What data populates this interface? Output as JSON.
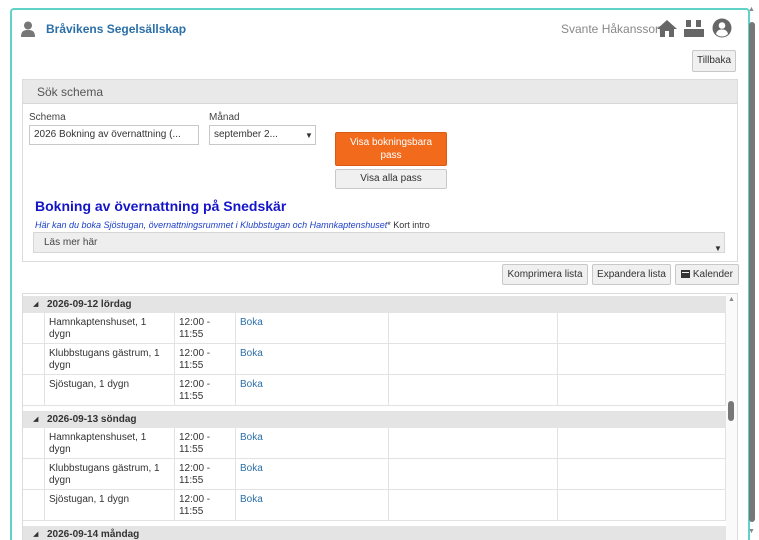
{
  "header": {
    "club_name": "Bråvikens Segelsällskap",
    "user_name": "Svante Håkansson"
  },
  "back_label": "Tillbaka",
  "search": {
    "panel_title": "Sök schema",
    "schema_label": "Schema",
    "schema_value": "2026 Bokning av övernattning (...",
    "month_label": "Månad",
    "month_value": "september 2...",
    "show_bookable": "Visa bokningsbara pass",
    "show_all": "Visa alla pass"
  },
  "booking": {
    "title": "Bokning av övernattning på Snedskär",
    "intro_italic": "Här kan du boka Sjöstugan, övernattningsrummet i Klubbstugan och Hamnkaptenshuset",
    "intro_suffix": "* Kort intro",
    "read_more": "Läs mer här"
  },
  "toolbar": {
    "compress": "Komprimera lista",
    "expand": "Expandera lista",
    "calendar": "Kalender"
  },
  "days": [
    {
      "label": "2026-09-12 lördag",
      "rows": [
        {
          "name": "Hamnkaptenshuset, 1 dygn",
          "time": "12:00 - 11:55",
          "action": "Boka"
        },
        {
          "name": "Klubbstugans gästrum, 1 dygn",
          "time": "12:00 - 11:55",
          "action": "Boka"
        },
        {
          "name": "Sjöstugan, 1 dygn",
          "time": "12:00 - 11:55",
          "action": "Boka"
        }
      ]
    },
    {
      "label": "2026-09-13 söndag",
      "rows": [
        {
          "name": "Hamnkaptenshuset, 1 dygn",
          "time": "12:00 - 11:55",
          "action": "Boka"
        },
        {
          "name": "Klubbstugans gästrum, 1 dygn",
          "time": "12:00 - 11:55",
          "action": "Boka"
        },
        {
          "name": "Sjöstugan, 1 dygn",
          "time": "12:00 - 11:55",
          "action": "Boka"
        }
      ]
    },
    {
      "label": "2026-09-14 måndag",
      "rows": []
    }
  ],
  "colors": {
    "accent": "#2b6fa8",
    "primary_button": "#f26b1d",
    "title": "#1414c8",
    "frame": "#5fd3c8"
  }
}
